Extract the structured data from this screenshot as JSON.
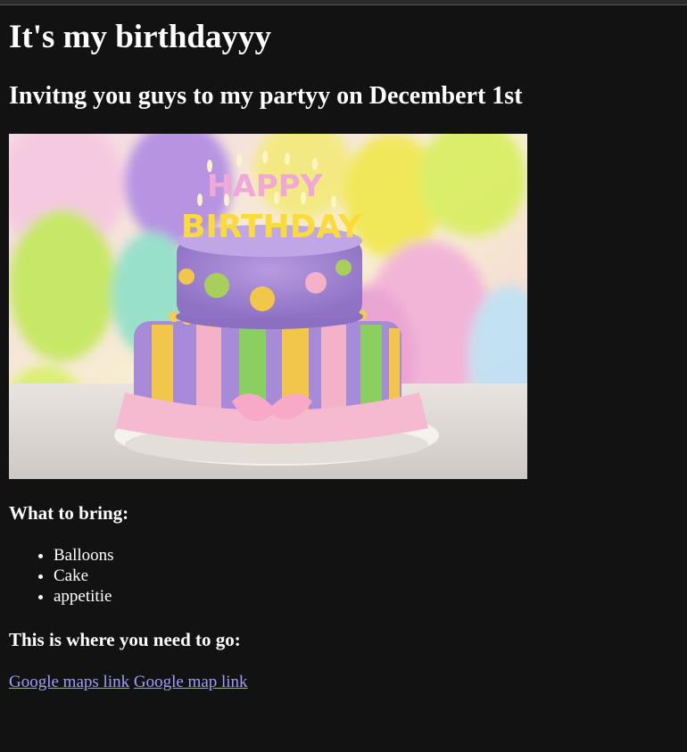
{
  "page": {
    "title": "It's my birthdayyy",
    "subtitle": "Invitng you guys to my partyy on Decembert 1st",
    "image_label": "Happy Birthday cake",
    "cake_topper": {
      "line1": "HAPPY",
      "line2": "BIRTHDAY"
    },
    "bring_heading": "What to bring:",
    "bring_items": [
      "Balloons",
      "Cake",
      "appetitie"
    ],
    "location_heading": "This is where you need to go:",
    "links": [
      "Google maps link",
      "Google map link"
    ]
  },
  "colors": {
    "background": "#121212",
    "text": "#ffffff",
    "link": "#9e9eff"
  }
}
